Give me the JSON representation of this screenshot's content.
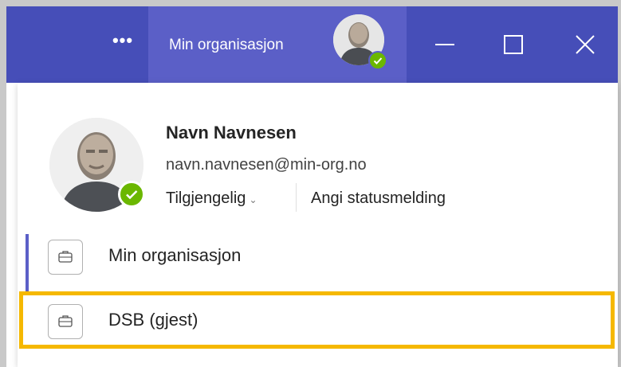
{
  "titlebar": {
    "more_label": "•••",
    "org_tab_label": "Min organisasjon",
    "colors": {
      "titlebar": "#464eb8",
      "active_tab": "#5b5fc7",
      "presence_available": "#6bb700"
    }
  },
  "profile": {
    "name": "Navn Navnesen",
    "email": "navn.navnesen@min-org.no",
    "status_label": "Tilgjengelig",
    "set_status_label": "Angi statusmelding"
  },
  "organizations": [
    {
      "label": "Min organisasjon",
      "icon": "briefcase-icon",
      "active": true
    },
    {
      "label": "DSB (gjest)",
      "icon": "briefcase-icon",
      "active": false,
      "highlight_color": "#f5b800"
    }
  ]
}
